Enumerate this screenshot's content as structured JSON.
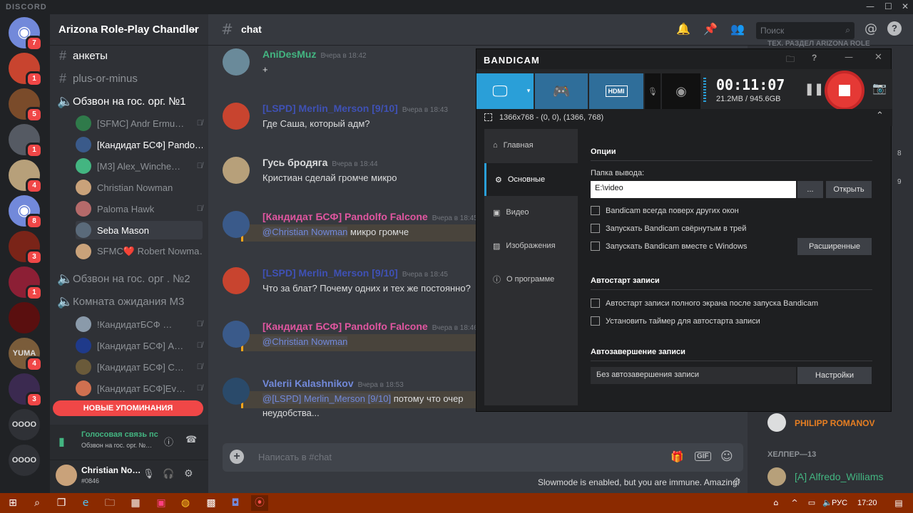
{
  "window": {
    "brand": "DISCORD",
    "minimize": "—",
    "maximize": "☐",
    "close": "✕"
  },
  "guilds": [
    {
      "badge": "7",
      "color": "#7289da",
      "glyph": "◉"
    },
    {
      "badge": "1",
      "color": "#c8442f",
      "glyph": ""
    },
    {
      "badge": "5",
      "color": "#7a4b2a",
      "glyph": ""
    },
    {
      "badge": "1",
      "color": "#555a63",
      "glyph": ""
    },
    {
      "badge": "4",
      "color": "#b7a07a",
      "glyph": ""
    },
    {
      "badge": "8",
      "color": "#7289da",
      "glyph": "◉"
    },
    {
      "badge": "3",
      "color": "#7a2418",
      "glyph": ""
    },
    {
      "badge": "1",
      "color": "#8c1f35",
      "glyph": ""
    },
    {
      "badge": "",
      "color": "#5a0f0f",
      "glyph": ""
    },
    {
      "badge": "4",
      "color": "#7a5c3a",
      "glyph": "YUMA"
    },
    {
      "badge": "3",
      "color": "#3b2a50",
      "glyph": ""
    },
    {
      "badge": "",
      "color": "#2f3136",
      "glyph": "OOOO"
    },
    {
      "badge": "",
      "color": "#2f3136",
      "glyph": "OOOO"
    }
  ],
  "server": {
    "name": "Arizona Role-Play Chandler"
  },
  "channels": [
    {
      "icon": "#",
      "label": "анкеты",
      "bright": true
    },
    {
      "icon": "#",
      "label": "plus-or-minus",
      "bright": false
    },
    {
      "icon": "🔈",
      "label": "Обзвон на гос. орг. №1",
      "bright": true
    }
  ],
  "voice1_users": [
    {
      "name": "[SFMC] Andr Ermu…",
      "color": "#2f7a4a",
      "muted": true
    },
    {
      "name": "[Кандидат БСФ] Pando…",
      "color": "#3a5a8a",
      "muted": false,
      "bright": true
    },
    {
      "name": "[M3] Alex_Winche…",
      "color": "#43b581",
      "muted": true
    },
    {
      "name": "Christian Nowman",
      "color": "#c9a27a",
      "muted": false
    },
    {
      "name": "Paloma Hawk",
      "color": "#b56a6a",
      "muted": true
    },
    {
      "name": "Seba Mason",
      "color": "#5a6a7a",
      "muted": false,
      "selected": true
    },
    {
      "name": "SFMC❤️ Robert Nowma…",
      "color": "#c9a27a",
      "muted": false
    }
  ],
  "channels2": [
    {
      "icon": "🔈",
      "label": "Обзвон на гос. орг . №2"
    },
    {
      "icon": "🔈",
      "label": "Комната ожидания М3"
    }
  ],
  "voice2_users": [
    {
      "name": "!КандидатБСФ …",
      "color": "#8a9aaa",
      "muted": true
    },
    {
      "name": "[Кандидат БСФ] A…",
      "color": "#1f3a8a",
      "muted": true
    },
    {
      "name": "[Кандидат БСФ] С…",
      "color": "#6a5a3a",
      "muted": true
    },
    {
      "name": "[Кандидат БСФ]Ev…",
      "color": "#d07050",
      "muted": true
    }
  ],
  "new_mentions": "НОВЫЕ УПОМИНАНИЯ",
  "voice_panel": {
    "status": "Голосовая связь пс",
    "sub": "Обзвон на гос. орг. №…"
  },
  "user_panel": {
    "name": "Christian No…",
    "tag": "#0846"
  },
  "chat": {
    "channel": "chat",
    "search_placeholder": "Поиск",
    "input_placeholder": "Написать в #chat",
    "slowmode": "Slowmode is enabled, but you are immune. Amazing!"
  },
  "messages": [
    {
      "author": "AniDesMuz",
      "color": "#43b581",
      "time": "Вчера в 18:42",
      "text": "+",
      "avatar": "#6a8a9a"
    },
    {
      "author": "[LSPD] Merlin_Merson [9/10]",
      "color": "#3f51b5",
      "time": "Вчера в 18:43",
      "text": "Где Саша, который адм?",
      "avatar": "#c8442f"
    },
    {
      "author": "Гусь бродяга",
      "color": "#dcddde",
      "time": "Вчера в 18:44",
      "text": "Кристиан сделай громче микро",
      "avatar": "#b7a07a"
    },
    {
      "author": "[Кандидат БСФ] Pandolfo Falcone",
      "color": "#e056a0",
      "time": "Вчера в 18:45",
      "mention": "@Christian Nowman",
      "text": " микро громче",
      "avatar": "#3a5a8a"
    },
    {
      "author": "[LSPD] Merlin_Merson [9/10]",
      "color": "#3f51b5",
      "time": "Вчера в 18:45",
      "text": "Что за блат? Почему одних и тех же постоянно?",
      "avatar": "#c8442f"
    },
    {
      "author": "[Кандидат БСФ] Pandolfo Falcone",
      "color": "#e056a0",
      "time": "Вчера в 18:46",
      "mention": "@Christian Nowman",
      "text": "",
      "avatar": "#3a5a8a"
    },
    {
      "author": "Valerii Kalashnikov",
      "color": "#7289da",
      "time": "Вчера в 18:53",
      "mention": "@[LSPD] Merlin_Merson [9/10]",
      "text": " потому что очер",
      "text2": "неудобства...",
      "avatar": "#2a4a6a"
    }
  ],
  "members": {
    "top_text": "ТЕХ. РАЗДЕЛ ARIZONA ROLE",
    "user1": "PHILIPP ROMANOV",
    "section": "ХЕЛПЕР—13",
    "user2": "[A] Alfredo_Williams",
    "side_nums": [
      "8",
      "9"
    ]
  },
  "bandicam": {
    "logo": "BANDICAM",
    "timer": "00:11:07",
    "size": "21.2MB / 945.6GB",
    "resolution": "1366x768 - (0, 0), (1366, 768)",
    "nav": [
      "Главная",
      "Основные",
      "Видео",
      "Изображения",
      "О программе"
    ],
    "options_title": "Опции",
    "output_label": "Папка вывода:",
    "output_value": "E:\\video",
    "browse": "...",
    "open": "Открыть",
    "checks": [
      "Bandicam всегда поверх других окон",
      "Запускать Bandicam свёрнутым в трей",
      "Запускать Bandicam вместе с Windows"
    ],
    "advanced": "Расширенные",
    "autostart_title": "Автостарт записи",
    "autostart_checks": [
      "Автостарт записи полного экрана после запуска Bandicam",
      "Установить таймер для автостарта записи"
    ],
    "autoend_title": "Автозавершение записи",
    "autoend_value": "Без автозавершения записи",
    "settings": "Настройки"
  },
  "taskbar": {
    "lang": "РУС",
    "time": "17:20"
  },
  "colors": {
    "accent": "#2a9fd8",
    "record": "#e53935",
    "taskbar": "#8b2a00"
  }
}
